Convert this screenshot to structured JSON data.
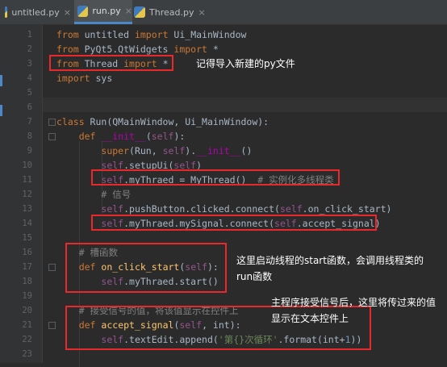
{
  "tabs": [
    {
      "label": "untitled.py",
      "close": "×"
    },
    {
      "label": "run.py",
      "close": "×"
    },
    {
      "label": "Thread.py",
      "close": "×"
    }
  ],
  "lines": [
    {
      "n": "1",
      "code": "<span class='kw'>from</span> untitled <span class='kw'>import</span> Ui_MainWindow"
    },
    {
      "n": "2",
      "code": "<span class='kw'>from</span> PyQt5.QtWidgets <span class='kw'>import</span> *"
    },
    {
      "n": "3",
      "code": "<span class='kw'>from</span> Thread <span class='kw'>import</span> *"
    },
    {
      "n": "4",
      "code": "<span class='kw'>import</span> sys"
    },
    {
      "n": "5",
      "code": ""
    },
    {
      "n": "6",
      "code": ""
    },
    {
      "n": "7",
      "code": "<span class='kw'>class</span> Run(QMainWindow, Ui_MainWindow):"
    },
    {
      "n": "8",
      "code": "    <span class='kw'>def</span> <span class='dnd'>__init__</span>(<span class='self'>self</span>):"
    },
    {
      "n": "9",
      "code": "        <span class='kw'>super</span>(Run, <span class='self'>self</span>).<span class='dnd'>__init__</span>()"
    },
    {
      "n": "10",
      "code": "        <span class='self'>self</span>.setupUi(<span class='self'>self</span>)"
    },
    {
      "n": "11",
      "code": "        <span class='self'>self</span>.myThraed = MyThread()  <span class='cm'># 实例化多线程类</span>"
    },
    {
      "n": "12",
      "code": "        <span class='cm'># 信号</span>"
    },
    {
      "n": "13",
      "code": "        <span class='self'>self</span>.pushButton.clicked.connect(<span class='self'>self</span>.on_click_start)"
    },
    {
      "n": "14",
      "code": "        <span class='self'>self</span>.myThraed.mySignal.connect(<span class='self'>self</span>.accept_signal)"
    },
    {
      "n": "15",
      "code": ""
    },
    {
      "n": "16",
      "code": "    <span class='cm'># 槽函数</span>"
    },
    {
      "n": "17",
      "code": "    <span class='kw'>def</span> <span class='fn'>on_click_start</span>(<span class='self'>self</span>):"
    },
    {
      "n": "18",
      "code": "        <span class='self'>self</span>.myThraed.start()"
    },
    {
      "n": "19",
      "code": ""
    },
    {
      "n": "20",
      "code": "    <span class='cm'># 接受信号的值，将该值显示在控件上</span>"
    },
    {
      "n": "21",
      "code": "    <span class='kw'>def</span> <span class='fn'>accept_signal</span>(<span class='self'>self</span>, int):"
    },
    {
      "n": "22",
      "code": "        <span class='self'>self</span>.textEdit.append(<span class='str'>'第{}次循环'</span>.format(int+<span class='num'>1</span>))"
    },
    {
      "n": "23",
      "code": ""
    }
  ],
  "annotations": {
    "import_note": "记得导入新建的py文件",
    "start_note": "这里启动线程的start函数，会调用线程类的run函数",
    "signal_note": "主程序接受信号后，这里将传过来的值显示在文本控件上"
  },
  "colors": {
    "highlight_box": "#e8282b",
    "accent_tab": "#4a88c7"
  }
}
